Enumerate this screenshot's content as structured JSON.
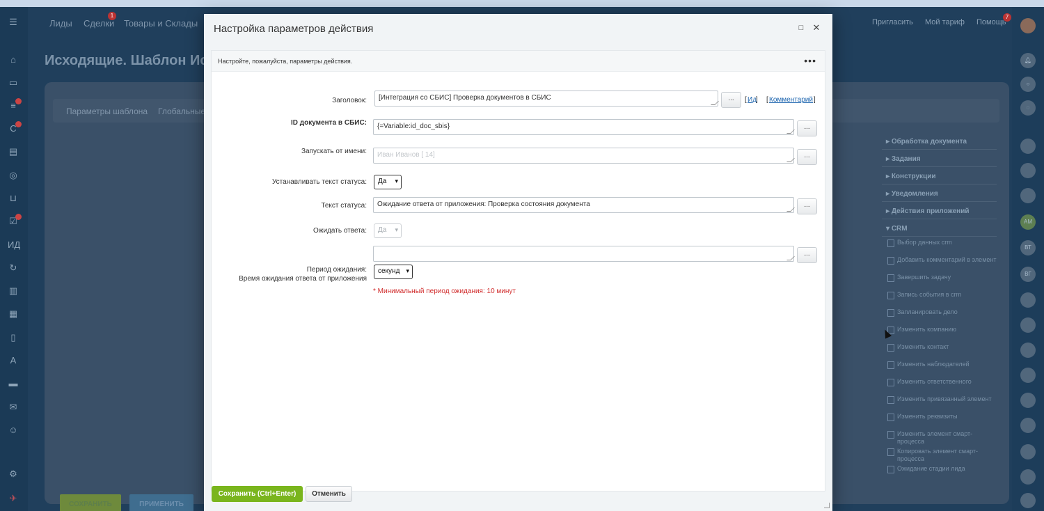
{
  "background": {
    "nav": [
      "Лиды",
      "Сделки",
      "Товары и Склады"
    ],
    "nav_badge": "1",
    "nav_right": [
      "Пригласить",
      "Мой тариф",
      "Помощь"
    ],
    "help_badge": "7",
    "page_title": "Исходящие. Шаблон Исх",
    "tabs": [
      "Параметры шаблона",
      "Глобальные"
    ],
    "robot_categories": [
      "Обработка документа",
      "Задания",
      "Конструкции",
      "Уведомления",
      "Действия приложений",
      "CRM"
    ],
    "robots": [
      "Выбор данных crm",
      "Добавить комментарий в элемент",
      "Завершить задачу",
      "Запись события в crm",
      "Запланировать дело",
      "Изменить компанию",
      "Изменить контакт",
      "Изменить наблюдателей",
      "Изменить ответственного",
      "Изменить привязанный элемент",
      "Изменить реквизиты",
      "Изменить элемент смарт-процесса",
      "Копировать элемент смарт-процесса",
      "Ожидание стадии лида"
    ],
    "save_label": "СОХРАНИТЬ",
    "apply_label": "ПРИМЕНИТЬ",
    "rail_avatars": [
      "ИД",
      "АМ",
      "ВТ",
      "ВГ"
    ]
  },
  "modal": {
    "title": "Настройка параметров действия",
    "intro": "Настройте, пожалуйста, параметры действия.",
    "fields": {
      "title_label": "Заголовок:",
      "title_value": "[Интеграция со СБИС] Проверка документов в СБИС",
      "id_link": "Ид",
      "comment_link": "Комментарий",
      "doc_id_label": "ID документа в СБИС:",
      "doc_id_value": "{=Variable:id_doc_sbis}",
      "run_as_label": "Запускать от имени:",
      "run_as_value": "Иван Иванов [ 14]",
      "set_status_label": "Устанавливать текст статуса:",
      "set_status_value": "Да",
      "status_text_label": "Текст статуса:",
      "status_text_value": "Ожидание ответа от приложения: Проверка состояния документа",
      "wait_label": "Ожидать ответа:",
      "wait_value": "Да",
      "period_label": "Период ожидания:",
      "period_sublabel": "Время ожидания ответа от приложения",
      "period_value": "",
      "period_unit": "секунд",
      "period_note": "* Минимальный период ожидания: 10 минут"
    },
    "dots": "...",
    "save_label": "Сохранить (Ctrl+Enter)",
    "cancel_label": "Отменить"
  },
  "colors": {
    "save": "#7ab51d",
    "link": "#2067b0",
    "note": "#d12d2d"
  }
}
